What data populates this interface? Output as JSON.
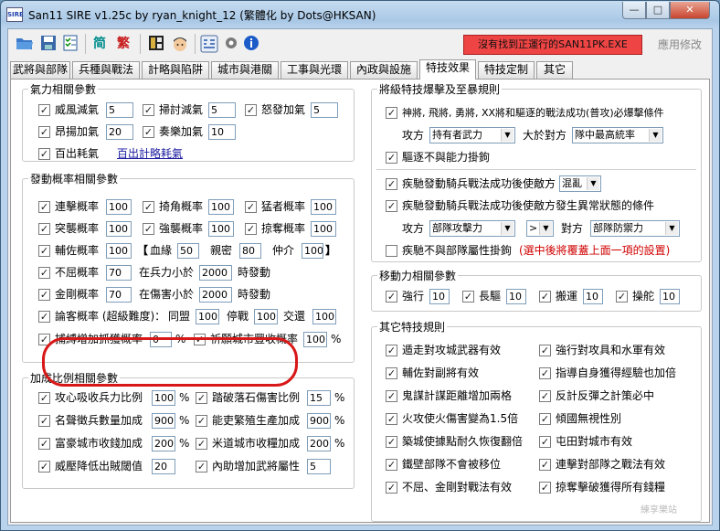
{
  "window": {
    "title": "San11 SIRE v1.25c by ryan_knight_12 (繁體化 by Dots@HKSAN)",
    "app_icon_text": "SIRE",
    "min": "—",
    "max": "□",
    "close": "✕"
  },
  "toolbar": {
    "simplified": "简",
    "traditional": "繁",
    "alert": "沒有找到正運行的SAN11PK.EXE",
    "apply": "應用修改"
  },
  "tabs": [
    "武將與部隊",
    "兵種與戰法",
    "計略與陷阱",
    "城市與港關",
    "工事與光環",
    "內政與設施",
    "特技效果",
    "特技定制",
    "其它"
  ],
  "left": {
    "g1": {
      "title": "氣力相關參數",
      "items": [
        {
          "label": "威風減氣",
          "value": "5"
        },
        {
          "label": "掃討減氣",
          "value": "5"
        },
        {
          "label": "怒發加氣",
          "value": "5"
        },
        {
          "label": "昂揚加氣",
          "value": "20"
        },
        {
          "label": "奏樂加氣",
          "value": "10"
        }
      ],
      "bkq": "百出耗氣",
      "bkq_link": "百出計略耗氣"
    },
    "g2": {
      "title": "發動概率相關參數",
      "r1": [
        {
          "label": "連擊概率",
          "value": "100"
        },
        {
          "label": "掎角概率",
          "value": "100"
        },
        {
          "label": "猛者概率",
          "value": "100"
        }
      ],
      "r2": [
        {
          "label": "突襲概率",
          "value": "100"
        },
        {
          "label": "強襲概率",
          "value": "100"
        },
        {
          "label": "掠奪概率",
          "value": "100"
        }
      ],
      "r3": {
        "label": "輔佐概率",
        "value": "100",
        "bl": "【",
        "xue": "血緣",
        "xue_v": "50",
        "qin": "親密",
        "qin_v": "80",
        "zhong": "仲介",
        "zhong_v": "100",
        "br": "】"
      },
      "bq": {
        "label": "不屈概率",
        "value": "70",
        "cond": "在兵力小於",
        "cond_v": "2000",
        "trig": "時發動"
      },
      "jg": {
        "label": "金剛概率",
        "value": "70",
        "cond": "在傷害小於",
        "cond_v": "2000",
        "trig": "時發動"
      },
      "lk": {
        "label": "論客概率 (超級難度)：",
        "tm": "同盟",
        "tm_v": "100",
        "tz": "停戰",
        "tz_v": "100",
        "jb": "交還",
        "jb_v": "100"
      },
      "bf": {
        "label": "捕縛增加抓獲概率",
        "value": "0",
        "pct": "%",
        "qx": "祈願城市豐收概率",
        "qx_v": "100",
        "pct2": "%"
      }
    },
    "g3": {
      "title": "加成比例相關參數",
      "rows": [
        [
          {
            "label": "攻心吸收兵力比例",
            "value": "100",
            "pct": "%"
          },
          {
            "label": "踏破落石傷害比例",
            "value": "15",
            "pct": "%"
          }
        ],
        [
          {
            "label": "名聲徵兵數量加成",
            "value": "900",
            "pct": "%"
          },
          {
            "label": "能吏繁殖生產加成",
            "value": "900",
            "pct": "%"
          }
        ],
        [
          {
            "label": "富豪城市收錢加成",
            "value": "200",
            "pct": "%"
          },
          {
            "label": "米道城市收糧加成",
            "value": "200",
            "pct": "%"
          }
        ],
        [
          {
            "label": "威壓降低出賊閾值",
            "value": "20",
            "pct": ""
          },
          {
            "label": "內助增加武將屬性",
            "value": "5",
            "pct": ""
          }
        ]
      ]
    }
  },
  "right": {
    "g4": {
      "title": "將級特技爆擊及至暴規則",
      "l1": "神將, 飛將, 勇將, XX將和驅逐的戰法成功(普攻)必爆擊條件",
      "att": "攻方",
      "att_sel": "持有者武力",
      "gt": "大於對方",
      "def_sel": "隊中最高統率",
      "l2": "驅逐不與能力掛鉤",
      "l3": "疾馳發動騎兵戰法成功後使敵方",
      "l3_sel": "混亂",
      "l4": "疾馳發動騎兵戰法成功後使敵方發生異常狀態的條件",
      "att2": "攻方",
      "att2_sel": "部隊攻擊力",
      "op": ">",
      "op2": "對方",
      "def2_sel": "部隊防禦力",
      "l5": "疾馳不與部隊屬性掛鉤",
      "l5_note": "(選中後將覆蓋上面一項的設置)"
    },
    "g5": {
      "title": "移動力相關參數",
      "items": [
        {
          "label": "強行",
          "value": "10"
        },
        {
          "label": "長驅",
          "value": "10"
        },
        {
          "label": "搬運",
          "value": "10"
        },
        {
          "label": "操舵",
          "value": "10"
        }
      ]
    },
    "g6": {
      "title": "其它特技規則",
      "left": [
        "遁走對攻城武器有效",
        "輔佐對副將有效",
        "鬼謀計謀距離增加兩格",
        "火攻使火傷害變為1.5倍",
        "築城使據點耐久恢復翻倍",
        "鐵壁部隊不會被移位",
        "不屈、金剛對戰法有效"
      ],
      "right": [
        "強行對攻具和水軍有效",
        "指導自身獲得經驗也加倍",
        "反計反彈之計策必中",
        "傾國無視性別",
        "屯田對城市有效",
        "連擊對部隊之戰法有效",
        "掠奪擊破獲得所有錢糧"
      ]
    }
  },
  "check": "✓",
  "watermark": "練享樂站"
}
